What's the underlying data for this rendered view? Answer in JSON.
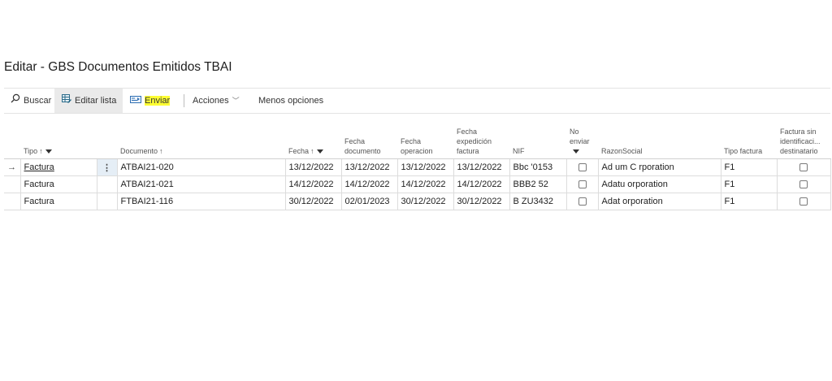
{
  "page": {
    "title": "Editar - GBS Documentos Emitidos TBAI"
  },
  "toolbar": {
    "search_label": "Buscar",
    "edit_list_label": "Editar lista",
    "send_label": "Enviar",
    "actions_label": "Acciones",
    "less_options_label": "Menos opciones"
  },
  "table": {
    "headers": {
      "tipo": "Tipo",
      "documento": "Documento",
      "fecha": "Fecha",
      "fecha_documento": "Fecha documento",
      "fecha_operacion": "Fecha operacion",
      "fecha_expedicion": "Fecha expedición factura",
      "nif": "NIF",
      "no_enviar": "No enviar",
      "razon_social": "RazonSocial",
      "tipo_factura": "Tipo factura",
      "factura_sin": "Factura sin identificaci... destinatario"
    },
    "rows": [
      {
        "tipo": "Factura",
        "documento": "ATBAI21-020",
        "fecha": "13/12/2022",
        "fecha_documento": "13/12/2022",
        "fecha_operacion": "13/12/2022",
        "fecha_expedicion": "13/12/2022",
        "nif": "Bbc  '0153",
        "razon_social": "Ad    um C   rporation",
        "tipo_factura": "F1"
      },
      {
        "tipo": "Factura",
        "documento": "ATBAI21-021",
        "fecha": "14/12/2022",
        "fecha_documento": "14/12/2022",
        "fecha_operacion": "14/12/2022",
        "fecha_expedicion": "14/12/2022",
        "nif": "BBB2      52",
        "razon_social": "Adatu    orporation",
        "tipo_factura": "F1"
      },
      {
        "tipo": "Factura",
        "documento": "FTBAI21-116",
        "fecha": "30/12/2022",
        "fecha_documento": "02/01/2023",
        "fecha_operacion": "30/12/2022",
        "fecha_expedicion": "30/12/2022",
        "nif": "B   ZU3432",
        "razon_social": "Adat     orporation",
        "tipo_factura": "F1"
      }
    ]
  }
}
